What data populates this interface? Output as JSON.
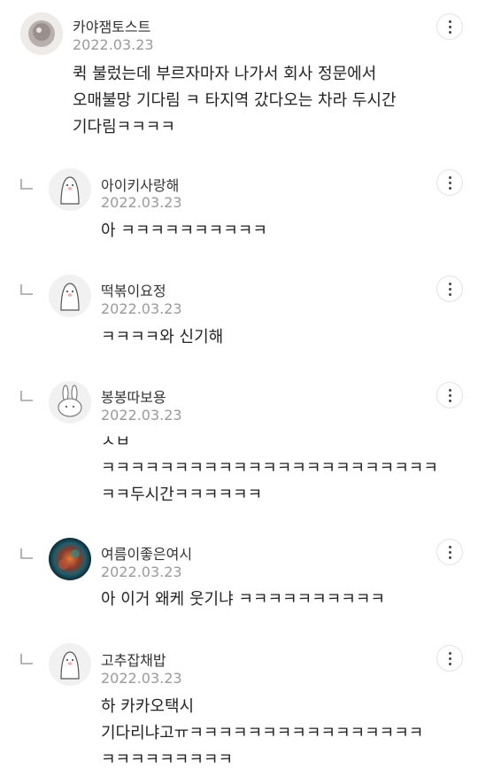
{
  "comments": [
    {
      "author": "카야잼토스트",
      "date": "2022.03.23",
      "text": "퀵 불렀는데 부르자마자 나가서 회사 정문에서\n오매불망 기다림 ㅋ 타지역 갔다오는 차라 두시간\n기다림ㅋㅋㅋㅋ",
      "is_reply": false
    },
    {
      "author": "아이키사랑해",
      "date": "2022.03.23",
      "text": "아 ㅋㅋㅋㅋㅋㅋㅋㅋㅋㅋ",
      "is_reply": true
    },
    {
      "author": "떡볶이요정",
      "date": "2022.03.23",
      "text": "ㅋㅋㅋㅋ와 신기해",
      "is_reply": true
    },
    {
      "author": "봉봉따보용",
      "date": "2022.03.23",
      "text": "ㅅㅂ\nㅋㅋㅋㅋㅋㅋㅋㅋㅋㅋㅋㅋㅋㅋㅋㅋㅋㅋㅋㅋㅋㅋㅋ\nㅋㅋ두시간ㅋㅋㅋㅋㅋㅋ",
      "is_reply": true
    },
    {
      "author": "여름이좋은여시",
      "date": "2022.03.23",
      "text": "아 이거 왜케 웃기냐 ㅋㅋㅋㅋㅋㅋㅋㅋㅋㅋ",
      "is_reply": true
    },
    {
      "author": "고추잡채밥",
      "date": "2022.03.23",
      "text": "하 카카오택시\n기다리냐고ㅠㅋㅋㅋㅋㅋㅋㅋㅋㅋㅋㅋㅋㅋㅋㅋㅋ\nㅋㅋㅋㅋㅋㅋㅋㅋㅋ",
      "is_reply": true
    }
  ],
  "colors": {
    "text": "#222222",
    "date": "#9a9a9a",
    "border": "#e3e3e3"
  },
  "icons": {
    "reply": "reply-arrow-icon",
    "more": "more-vertical-icon",
    "avatar_ghost": "ghost-avatar-icon",
    "avatar_rabbit": "rabbit-avatar-icon",
    "avatar_photo": "photo-avatar"
  }
}
